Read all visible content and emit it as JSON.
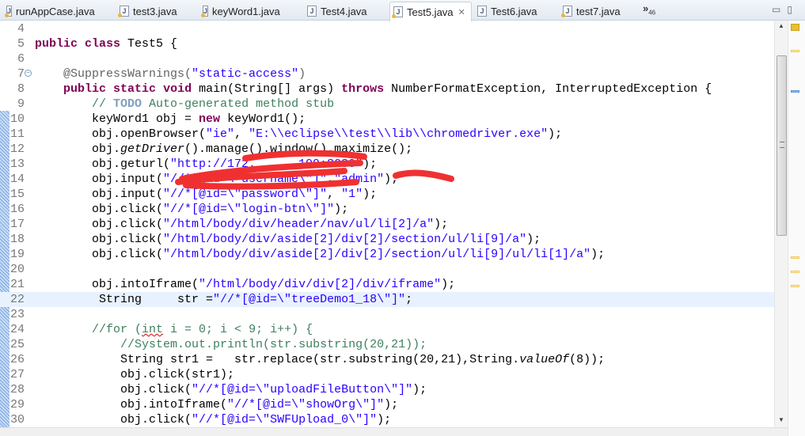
{
  "tabs": [
    {
      "label": "runAppCase.java",
      "modified": true
    },
    {
      "label": "test3.java",
      "modified": true
    },
    {
      "label": "keyWord1.java",
      "modified": true
    },
    {
      "label": "Test4.java",
      "modified": false
    },
    {
      "label": "Test5.java",
      "modified": true,
      "active": true,
      "close": "✕"
    },
    {
      "label": "Test6.java",
      "modified": false
    },
    {
      "label": "test7.java",
      "modified": true
    }
  ],
  "overflow": {
    "chevron": "»",
    "count": "46"
  },
  "colors": {
    "keyword": "#7f0055",
    "string": "#2a00ff",
    "comment": "#3f7f5f",
    "current_line": "#e8f2fe",
    "redaction": "#f03030"
  },
  "editor": {
    "current_line": 22,
    "lines": [
      {
        "n": "4",
        "seg": []
      },
      {
        "n": "5",
        "seg": [
          [
            "kw",
            "public"
          ],
          [
            "pl",
            " "
          ],
          [
            "kw",
            "class"
          ],
          [
            "pl",
            " Test5 {"
          ]
        ]
      },
      {
        "n": "6",
        "seg": []
      },
      {
        "n": "7",
        "fold": "−",
        "seg": [
          [
            "pl",
            "    "
          ],
          [
            "ann",
            "@SuppressWarnings("
          ],
          [
            "str",
            "\"static-access\""
          ],
          [
            "ann",
            ")"
          ]
        ]
      },
      {
        "n": "8",
        "seg": [
          [
            "pl",
            "    "
          ],
          [
            "kw",
            "public"
          ],
          [
            "pl",
            " "
          ],
          [
            "kw",
            "static"
          ],
          [
            "pl",
            " "
          ],
          [
            "kw",
            "void"
          ],
          [
            "pl",
            " main(String[] args) "
          ],
          [
            "kw",
            "throws"
          ],
          [
            "pl",
            " NumberFormatException, InterruptedException {"
          ]
        ]
      },
      {
        "n": "9",
        "seg": [
          [
            "pl",
            "        "
          ],
          [
            "cm",
            "// "
          ],
          [
            "todo",
            "TODO"
          ],
          [
            "cm",
            " Auto-generated method stub"
          ]
        ]
      },
      {
        "n": "10",
        "seg": [
          [
            "pl",
            "        keyWord1 obj = "
          ],
          [
            "kw",
            "new"
          ],
          [
            "pl",
            " keyWord1();"
          ]
        ]
      },
      {
        "n": "11",
        "seg": [
          [
            "pl",
            "        obj.openBrowser("
          ],
          [
            "str",
            "\"ie\""
          ],
          [
            "pl",
            ", "
          ],
          [
            "str",
            "\"E:\\\\eclipse\\\\test\\\\lib\\\\chromedriver.exe\""
          ],
          [
            "pl",
            ");"
          ]
        ]
      },
      {
        "n": "12",
        "seg": [
          [
            "pl",
            "        obj."
          ],
          [
            "it",
            "getDriver"
          ],
          [
            "pl",
            "().manage().window().maximize();"
          ]
        ]
      },
      {
        "n": "13",
        "seg": [
          [
            "pl",
            "        obj.geturl("
          ],
          [
            "str",
            "\"http://172.  .  .109:8080\""
          ],
          [
            "pl",
            ");"
          ]
        ]
      },
      {
        "n": "14",
        "seg": [
          [
            "pl",
            "        obj.input("
          ],
          [
            "str",
            "\"//*[@id=\\\"username\\\"]\""
          ],
          [
            "pl",
            ","
          ],
          [
            "str",
            "\"admin\""
          ],
          [
            "pl",
            ");"
          ]
        ]
      },
      {
        "n": "15",
        "seg": [
          [
            "pl",
            "        obj.input("
          ],
          [
            "str",
            "\"//*[@id=\\\"password\\\"]\""
          ],
          [
            "pl",
            ", "
          ],
          [
            "str",
            "\"1\""
          ],
          [
            "pl",
            ");"
          ]
        ]
      },
      {
        "n": "16",
        "seg": [
          [
            "pl",
            "        obj.click("
          ],
          [
            "str",
            "\"//*[@id=\\\"login-btn\\\"]\""
          ],
          [
            "pl",
            ");"
          ]
        ]
      },
      {
        "n": "17",
        "seg": [
          [
            "pl",
            "        obj.click("
          ],
          [
            "str",
            "\"/html/body/div/header/nav/ul/li[2]/a\""
          ],
          [
            "pl",
            ");"
          ]
        ]
      },
      {
        "n": "18",
        "seg": [
          [
            "pl",
            "        obj.click("
          ],
          [
            "str",
            "\"/html/body/div/aside[2]/div[2]/section/ul/li[9]/a\""
          ],
          [
            "pl",
            ");"
          ]
        ]
      },
      {
        "n": "19",
        "seg": [
          [
            "pl",
            "        obj.click("
          ],
          [
            "str",
            "\"/html/body/div/aside[2]/div[2]/section/ul/li[9]/ul/li[1]/a\""
          ],
          [
            "pl",
            ");"
          ]
        ]
      },
      {
        "n": "20",
        "seg": []
      },
      {
        "n": "21",
        "seg": [
          [
            "pl",
            "        obj.intoIframe("
          ],
          [
            "str",
            "\"/html/body/div/div[2]/div/iframe\""
          ],
          [
            "pl",
            ");"
          ]
        ]
      },
      {
        "n": "22",
        "seg": [
          [
            "pl",
            "         String     str ="
          ],
          [
            "str",
            "\"//*[@id=\\\"treeDemo1_18\\\"]\""
          ],
          [
            "pl",
            ";"
          ]
        ]
      },
      {
        "n": "23",
        "seg": []
      },
      {
        "n": "24",
        "seg": [
          [
            "pl",
            "        "
          ],
          [
            "cm",
            "//for ("
          ],
          [
            "cmsq",
            "int"
          ],
          [
            "cm",
            " i = 0; i < 9; i++) {"
          ]
        ]
      },
      {
        "n": "25",
        "seg": [
          [
            "pl",
            "            "
          ],
          [
            "cm",
            "//System.out.println(str.substring(20,21));"
          ]
        ]
      },
      {
        "n": "26",
        "seg": [
          [
            "pl",
            "            String str1 =   str.replace(str.substring(20,21),String."
          ],
          [
            "it",
            "valueOf"
          ],
          [
            "pl",
            "(8));"
          ]
        ]
      },
      {
        "n": "27",
        "seg": [
          [
            "pl",
            "            obj.click(str1);"
          ]
        ]
      },
      {
        "n": "28",
        "seg": [
          [
            "pl",
            "            obj.click("
          ],
          [
            "str",
            "\"//*[@id=\\\"uploadFileButton\\\"]\""
          ],
          [
            "pl",
            ");"
          ]
        ]
      },
      {
        "n": "29",
        "seg": [
          [
            "pl",
            "            obj.intoIframe("
          ],
          [
            "str",
            "\"//*[@id=\\\"showOrg\\\"]\""
          ],
          [
            "pl",
            ");"
          ]
        ]
      },
      {
        "n": "30",
        "seg": [
          [
            "pl",
            "            obj.click("
          ],
          [
            "str",
            "\"//*[@id=\\\"SWFUpload_0\\\"]\""
          ],
          [
            "pl",
            ");"
          ]
        ]
      }
    ]
  }
}
